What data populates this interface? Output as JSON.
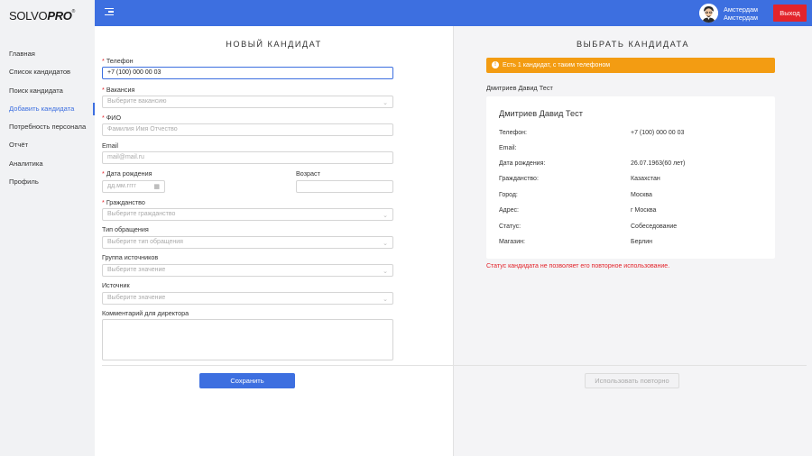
{
  "logo": {
    "main": "SOLVO",
    "strong": "PRO",
    "mark": "®"
  },
  "sidebar": {
    "items": [
      {
        "label": "Главная"
      },
      {
        "label": "Список кандидатов"
      },
      {
        "label": "Поиск кандидата"
      },
      {
        "label": "Добавить кандидата"
      },
      {
        "label": "Потребность персонала"
      },
      {
        "label": "Отчёт"
      },
      {
        "label": "Аналитика"
      },
      {
        "label": "Профиль"
      }
    ]
  },
  "header": {
    "user_line1": "Амстердам",
    "user_line2": "Амстердам",
    "logout_label": "Выход"
  },
  "form": {
    "title": "НОВЫЙ КАНДИДАТ",
    "phone_label": "Телефон",
    "phone_value": "+7 (100) 000 00 03",
    "vacancy_label": "Вакансия",
    "vacancy_placeholder": "Выберите вакансию",
    "fio_label": "ФИО",
    "fio_placeholder": "Фамилия Имя Отчество",
    "email_label": "Email",
    "email_placeholder": "mail@mail.ru",
    "birth_label": "Дата рождения",
    "birth_placeholder": "дд.мм.гггг",
    "age_label": "Возраст",
    "citizenship_label": "Гражданство",
    "citizenship_placeholder": "Выберите гражданство",
    "appeal_label": "Тип обращения",
    "appeal_placeholder": "Выберите тип обращения",
    "source_group_label": "Группа источников",
    "source_group_placeholder": "Выберите значение",
    "source_label": "Источник",
    "source_placeholder": "Выберите значение",
    "comment_label": "Комментарий для директора",
    "save_label": "Сохранить"
  },
  "select_panel": {
    "title": "ВЫБРАТЬ КАНДИДАТА",
    "alert_text": "Есть 1 кандидат, с таким телефоном",
    "candidate_name": "Дмитриев Давид Тест",
    "card": {
      "title": "Дмитриев Давид Тест",
      "rows": [
        {
          "key": "Телефон:",
          "value": "+7 (100) 000 00 03"
        },
        {
          "key": "Email:",
          "value": ""
        },
        {
          "key": "Дата рождения:",
          "value": "26.07.1963(60 лет)"
        },
        {
          "key": "Гражданство:",
          "value": "Казахстан"
        },
        {
          "key": "Город:",
          "value": "Москва"
        },
        {
          "key": "Адрес:",
          "value": "г Москва"
        },
        {
          "key": "Статус:",
          "value": "Собеседование"
        },
        {
          "key": "Магазин:",
          "value": "Берлин"
        }
      ]
    },
    "error_text": "Статус кандидата не позволяет его повторное использование.",
    "reuse_label": "Использовать повторно"
  },
  "colors": {
    "accent": "#3d6fe0",
    "danger": "#e3242b",
    "warning": "#f39c12"
  }
}
